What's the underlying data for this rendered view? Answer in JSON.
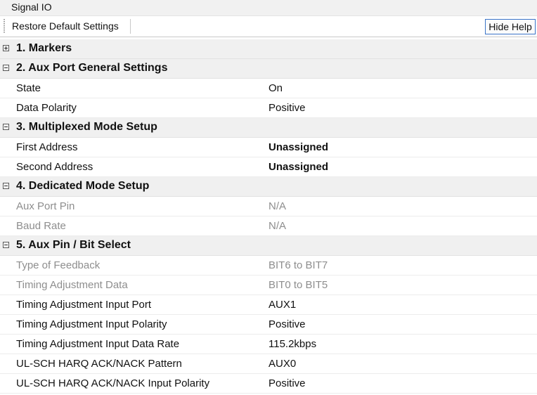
{
  "window": {
    "title": "Signal IO"
  },
  "toolbar": {
    "restore_label": "Restore Default Settings",
    "hide_help_label": "Hide Help"
  },
  "sections": [
    {
      "label": "1. Markers",
      "expanded": false,
      "rows": []
    },
    {
      "label": "2. Aux Port General Settings",
      "expanded": true,
      "rows": [
        {
          "name": "State",
          "value": "On",
          "bold": false,
          "disabled": false
        },
        {
          "name": "Data Polarity",
          "value": "Positive",
          "bold": false,
          "disabled": false
        }
      ]
    },
    {
      "label": "3. Multiplexed Mode Setup",
      "expanded": true,
      "rows": [
        {
          "name": "First Address",
          "value": "Unassigned",
          "bold": true,
          "disabled": false
        },
        {
          "name": "Second Address",
          "value": "Unassigned",
          "bold": true,
          "disabled": false
        }
      ]
    },
    {
      "label": "4. Dedicated Mode Setup",
      "expanded": true,
      "rows": [
        {
          "name": "Aux Port Pin",
          "value": "N/A",
          "bold": false,
          "disabled": true
        },
        {
          "name": "Baud Rate",
          "value": "N/A",
          "bold": false,
          "disabled": true
        }
      ]
    },
    {
      "label": "5. Aux Pin / Bit Select",
      "expanded": true,
      "rows": [
        {
          "name": "Type of Feedback",
          "value": "BIT6 to BIT7",
          "bold": false,
          "disabled": true
        },
        {
          "name": "Timing Adjustment Data",
          "value": "BIT0 to BIT5",
          "bold": false,
          "disabled": true
        },
        {
          "name": "Timing Adjustment Input Port",
          "value": "AUX1",
          "bold": false,
          "disabled": false
        },
        {
          "name": "Timing Adjustment Input Polarity",
          "value": "Positive",
          "bold": false,
          "disabled": false
        },
        {
          "name": "Timing Adjustment Input Data Rate",
          "value": "115.2kbps",
          "bold": false,
          "disabled": false
        },
        {
          "name": "UL-SCH HARQ ACK/NACK Pattern",
          "value": "AUX0",
          "bold": false,
          "disabled": false
        },
        {
          "name": "UL-SCH HARQ ACK/NACK Input Polarity",
          "value": "Positive",
          "bold": false,
          "disabled": false
        }
      ]
    }
  ]
}
